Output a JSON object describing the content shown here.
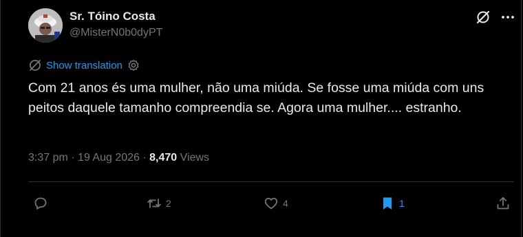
{
  "author": {
    "display_name": "Sr. Tóino Costa",
    "handle": "@MisterN0b0dyPT"
  },
  "translation": {
    "label": "Show translation"
  },
  "tweet": {
    "text": "Com 21 anos és uma mulher, não uma miúda.  Se fosse uma miúda com uns peitos daquele tamanho compreendia se. Agora uma mulher.... estranho."
  },
  "meta": {
    "time": "3:37 pm",
    "separator": "·",
    "date": "19 Aug 2026",
    "views_count": "8,470",
    "views_label": "Views"
  },
  "actions": {
    "replies": "",
    "reposts": "2",
    "likes": "4",
    "bookmarks": "1"
  },
  "colors": {
    "background": "#000000",
    "text": "#e7e9ea",
    "secondary": "#71767b",
    "accent": "#1d9bf0",
    "divider": "#2f3336"
  },
  "icons": {
    "top_right": [
      "grok-icon",
      "more-icon"
    ],
    "translation": [
      "globe-icon",
      "settings-icon"
    ],
    "actions": [
      "reply-icon",
      "repost-icon",
      "like-icon",
      "bookmark-icon",
      "share-icon"
    ]
  }
}
